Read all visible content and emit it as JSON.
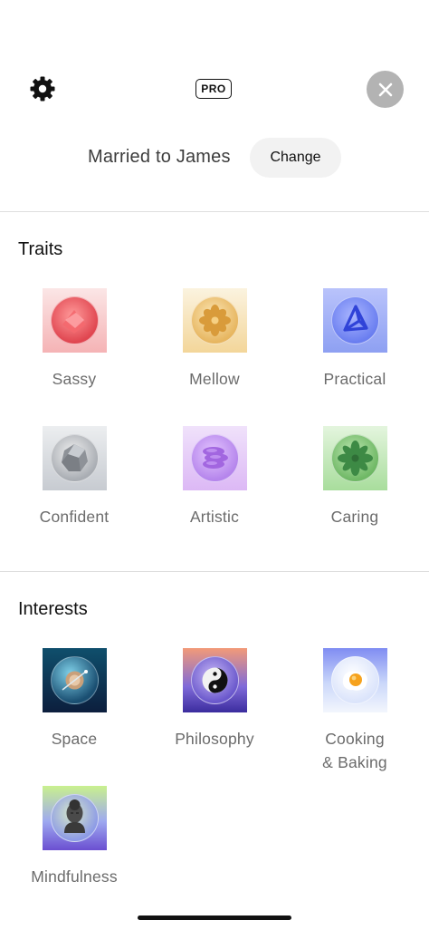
{
  "header": {
    "pro_badge": "PRO",
    "relationship_text": "Married to James",
    "change_label": "Change"
  },
  "traits": {
    "title": "Traits",
    "items": [
      {
        "label": "Sassy",
        "icon": "sassy-trait-icon",
        "color": "#e8595f"
      },
      {
        "label": "Mellow",
        "icon": "mellow-trait-icon",
        "color": "#e8b44c"
      },
      {
        "label": "Practical",
        "icon": "practical-trait-icon",
        "color": "#4a5de8"
      },
      {
        "label": "Confident",
        "icon": "confident-trait-icon",
        "color": "#9aa0a8"
      },
      {
        "label": "Artistic",
        "icon": "artistic-trait-icon",
        "color": "#b57be8"
      },
      {
        "label": "Caring",
        "icon": "caring-trait-icon",
        "color": "#3f9a4a"
      }
    ]
  },
  "interests": {
    "title": "Interests",
    "items": [
      {
        "label": "Space",
        "icon": "space-interest-icon"
      },
      {
        "label": "Philosophy",
        "icon": "philosophy-interest-icon"
      },
      {
        "label_line1": "Cooking",
        "label_line2": "& Baking",
        "icon": "cooking-interest-icon"
      },
      {
        "label": "Mindfulness",
        "icon": "mindfulness-interest-icon"
      }
    ]
  }
}
